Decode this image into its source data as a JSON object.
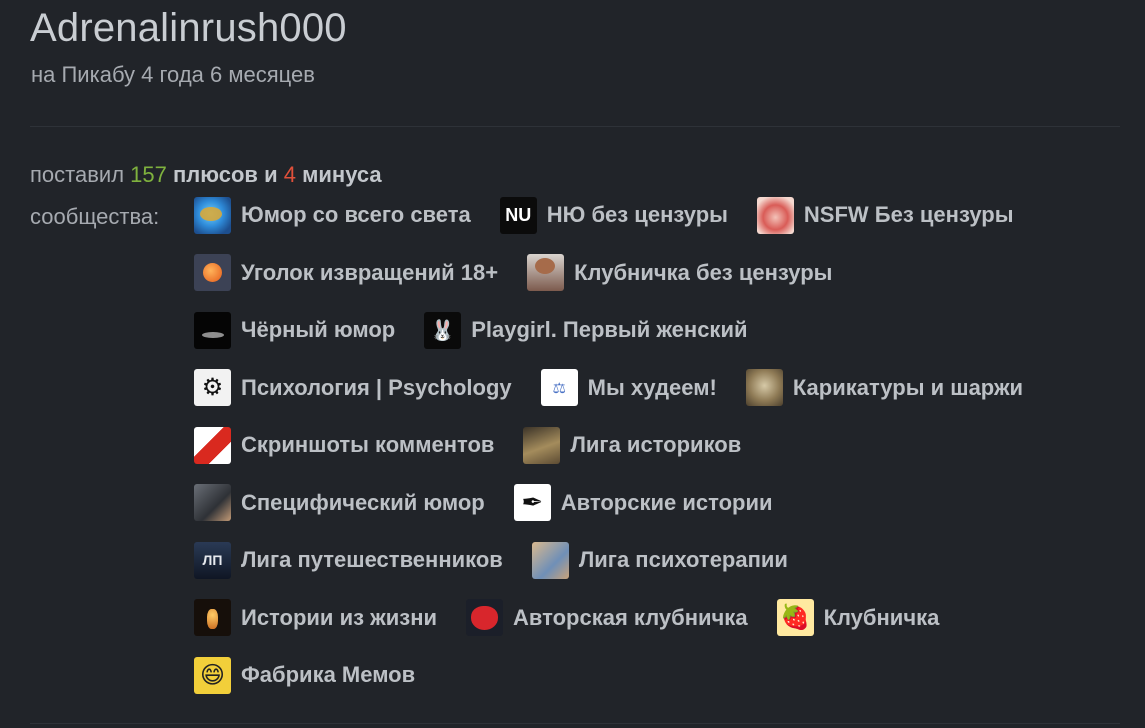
{
  "profile": {
    "username": "Adrenalinrush000",
    "tenure": "на Пикабу 4 года 6 месяцев"
  },
  "votes": {
    "prefix": "поставил",
    "plus_count": "157",
    "plus_word": "плюсов и",
    "minus_count": "4",
    "minus_word": "минуса"
  },
  "communities": {
    "label": "сообщества:",
    "rows": [
      [
        {
          "name": "Юмор со всего света",
          "icon": "globe-avatar"
        },
        {
          "name": "НЮ без цензуры",
          "icon": "nu-avatar",
          "glyph": "NU"
        },
        {
          "name": "NSFW Без цензуры",
          "icon": "nsfw-avatar"
        }
      ],
      [
        {
          "name": "Уголок извращений 18+",
          "icon": "corner-avatar"
        },
        {
          "name": "Клубничка без цензуры",
          "icon": "photo-avatar"
        }
      ],
      [
        {
          "name": "Чёрный юмор",
          "icon": "black-avatar"
        },
        {
          "name": "Playgirl. Первый женский",
          "icon": "bunny-avatar",
          "glyph": "🐰"
        }
      ],
      [
        {
          "name": "Психология | Psychology",
          "icon": "brain-avatar",
          "glyph": "⚙"
        },
        {
          "name": "Мы худеем!",
          "icon": "scale-avatar",
          "glyph": "⚖"
        },
        {
          "name": "Карикатуры и шаржи",
          "icon": "caricature-avatar"
        }
      ],
      [
        {
          "name": "Скриншоты комментов",
          "icon": "screenshot-avatar"
        },
        {
          "name": "Лига историков",
          "icon": "history-avatar"
        }
      ],
      [
        {
          "name": "Специфический юмор",
          "icon": "specific-avatar"
        },
        {
          "name": "Авторские истории",
          "icon": "feather-avatar",
          "glyph": "✒"
        }
      ],
      [
        {
          "name": "Лига путешественников",
          "icon": "travel-avatar",
          "glyph": "ЛП"
        },
        {
          "name": "Лига психотерапии",
          "icon": "psychotherapy-avatar"
        }
      ],
      [
        {
          "name": "Истории из жизни",
          "icon": "candle-avatar"
        },
        {
          "name": "Авторская клубничка",
          "icon": "strawberry-badge-avatar"
        },
        {
          "name": "Клубничка",
          "icon": "strawberry-avatar",
          "glyph": "🍓"
        }
      ],
      [
        {
          "name": "Фабрика Мемов",
          "icon": "meme-face-avatar",
          "glyph": "😄"
        }
      ]
    ]
  },
  "colors": {
    "background": "#212429",
    "plus": "#7fb23e",
    "minus": "#e0503a"
  }
}
